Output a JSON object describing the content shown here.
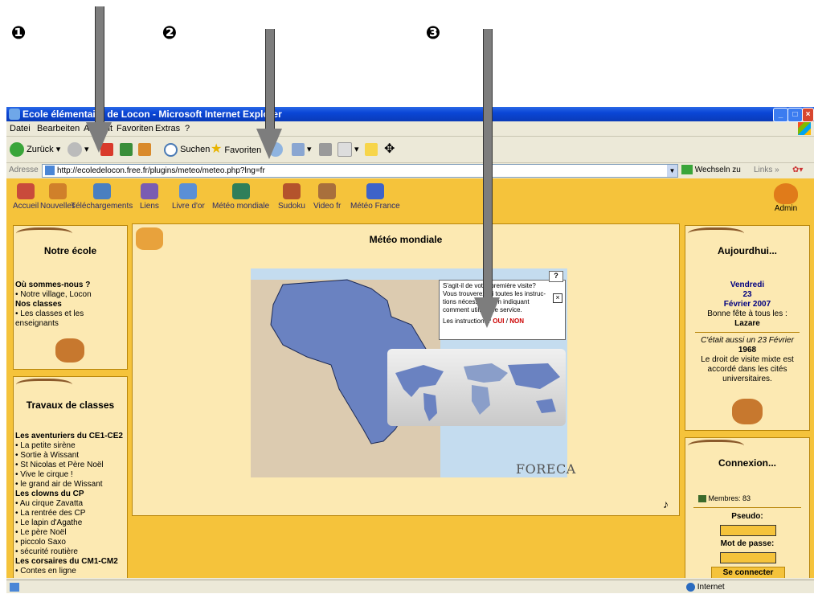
{
  "annotations": {
    "marker_1": "❶",
    "marker_2": "❷",
    "marker_3": "❸"
  },
  "window": {
    "title": "Ecole élémentaire de Locon - Microsoft Internet Explorer",
    "menu": [
      "Datei",
      "Bearbeiten",
      "Ansicht",
      "Favoriten",
      "Extras",
      "?"
    ],
    "toolbar": {
      "back": "Zurück",
      "search": "Suchen",
      "favorites": "Favoriten"
    },
    "address": {
      "label": "Adresse",
      "url": "http://ecoledelocon.free.fr/plugins/meteo/meteo.php?lng=fr",
      "go": "Wechseln zu",
      "links": "Links"
    },
    "status": {
      "zone": "Internet"
    }
  },
  "nav": [
    "Accueil",
    "Nouvelles",
    "Téléchargements",
    "Liens",
    "Livre d'or",
    "Météo mondiale",
    "Sudoku",
    "Video fr",
    "Météo France"
  ],
  "admin_label": "Admin",
  "left": {
    "school_title": "Notre école",
    "school_links": {
      "h1": "Où sommes-nous ?",
      "l1": "• Notre village, Locon",
      "h2": "Nos classes",
      "l2": "• Les classes et les enseignants"
    },
    "travaux_title": "Travaux de classes",
    "travaux": [
      {
        "t": "Les aventuriers du CE1-CE2",
        "h": true
      },
      {
        "t": "• La petite sirène"
      },
      {
        "t": "• Sortie à Wissant"
      },
      {
        "t": "• St Nicolas et Père Noël"
      },
      {
        "t": "• Vive le cirque !"
      },
      {
        "t": "• le grand air de Wissant"
      },
      {
        "t": "Les clowns du CP",
        "h": true
      },
      {
        "t": "• Au cirque Zavatta"
      },
      {
        "t": "• La rentrée des CP"
      },
      {
        "t": "• Le lapin d'Agathe"
      },
      {
        "t": "• Le père Noël"
      },
      {
        "t": "• piccolo Saxo"
      },
      {
        "t": "• sécurité routière"
      },
      {
        "t": "Les corsaires du CM1-CM2",
        "h": true
      },
      {
        "t": "• Contes en ligne"
      }
    ]
  },
  "main": {
    "title": "Météo mondiale",
    "popup": {
      "help": "?",
      "line1": "S'agit-il de votre première visite?",
      "line2": "Vous trouverez ici toutes les instruc-",
      "line3": "tions nécessaires en indiquant",
      "line4": "comment utiliser ce service.",
      "question": "Les instructions?",
      "oui": "OUI",
      "sep": "/",
      "non": "NON"
    },
    "brand": "FORECA"
  },
  "right": {
    "today_title": "Aujourdhui...",
    "day": "Vendredi",
    "date_num": "23",
    "month_year": "Février 2007",
    "fete": "Bonne fête à tous les :",
    "fete_name": "Lazare",
    "aussi": "C'était aussi un 23 Février",
    "year": "1968",
    "event": "Le droit de visite mixte est accordé dans les cités universitaires.",
    "conn_title": "Connexion...",
    "members": "Membres: 83",
    "pseudo": "Pseudo:",
    "password": "Mot de passe:",
    "connect": "Se connecter"
  },
  "colors": {
    "page_bg": "#f5c33b",
    "panel_bg": "#fce9b2",
    "link_blue": "#000080",
    "non_red": "#cc0000"
  }
}
